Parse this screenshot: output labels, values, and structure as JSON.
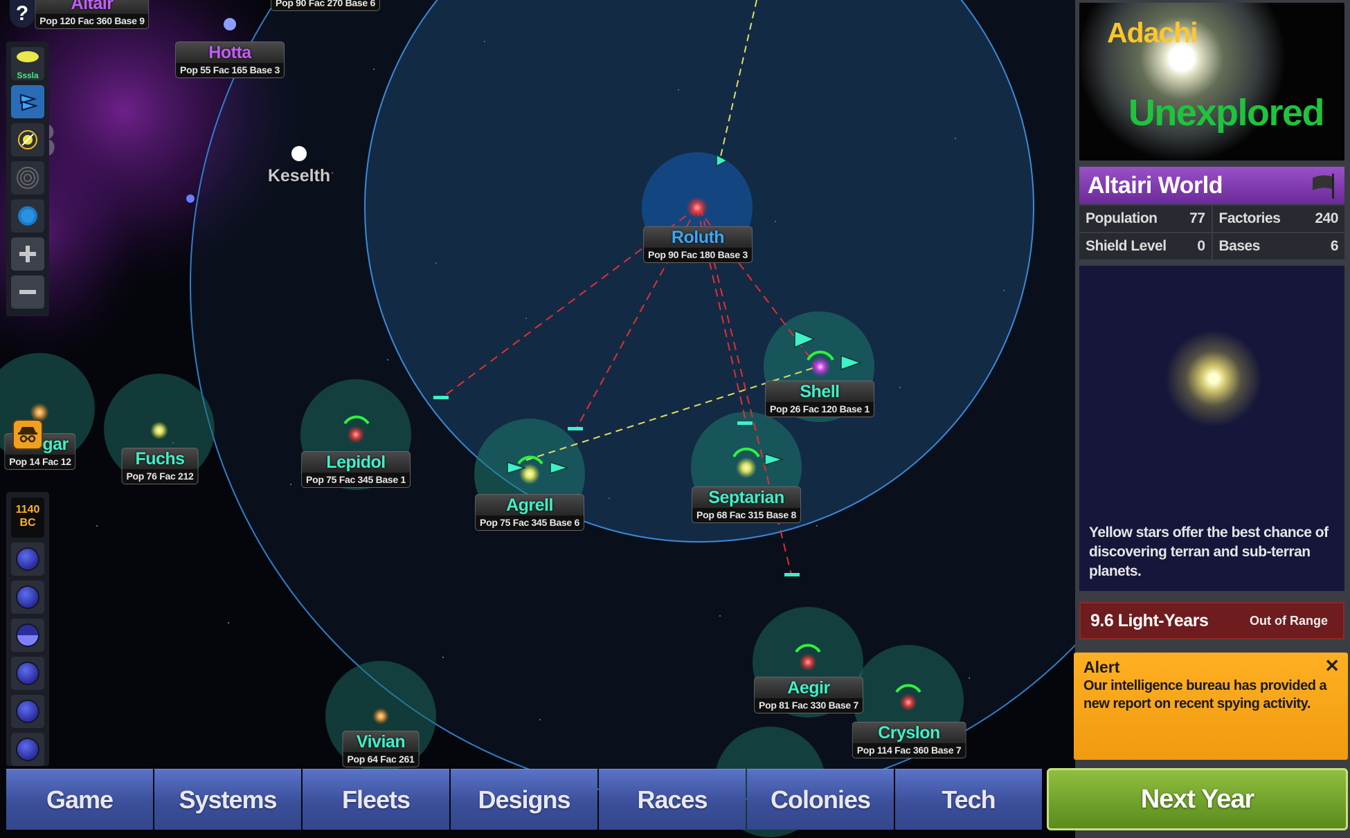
{
  "colors": {
    "accent_name": "#3ff0c8",
    "player_blue": "#3aa8ff",
    "altairi_purple": "#c55cff",
    "nav_blue": "#3b4f9a",
    "next_year_green": "#6fa12a",
    "alert_orange": "#f5a21a",
    "out_of_range_red": "#6e1c1e",
    "star_name_gold": "#ffc629",
    "unexplored_green": "#1ec43e"
  },
  "map": {
    "turn_number_partial": "78",
    "labels": {
      "keselth": "Keselth"
    },
    "systems": [
      {
        "id": "altair",
        "name": "Altair",
        "stats": "Pop 120  Fac 360  Base 9",
        "color": "purple"
      },
      {
        "id": "topcut",
        "name": "",
        "stats": "Pop 90  Fac 270  Base 6",
        "color": "green"
      },
      {
        "id": "hotta",
        "name": "Hotta",
        "stats": "Pop 55  Fac 165  Base 3",
        "color": "purple"
      },
      {
        "id": "roluth",
        "name": "Roluth",
        "stats": "Pop 90  Fac 180  Base 3",
        "color": "blue"
      },
      {
        "id": "shell",
        "name": "Shell",
        "stats": "Pop 26  Fac 120  Base 1",
        "color": "green"
      },
      {
        "id": "gar",
        "name": "gar",
        "stats": "Pop 14  Fac 12",
        "color": "green"
      },
      {
        "id": "fuchs",
        "name": "Fuchs",
        "stats": "Pop 76  Fac 212",
        "color": "green"
      },
      {
        "id": "lepidol",
        "name": "Lepidol",
        "stats": "Pop 75  Fac 345  Base 1",
        "color": "green"
      },
      {
        "id": "agrell",
        "name": "Agrell",
        "stats": "Pop 75  Fac 345  Base 6",
        "color": "green"
      },
      {
        "id": "septarian",
        "name": "Septarian",
        "stats": "Pop 68  Fac 315  Base 8",
        "color": "green"
      },
      {
        "id": "aegir",
        "name": "Aegir",
        "stats": "Pop 81  Fac 330  Base 7",
        "color": "green"
      },
      {
        "id": "cryslon",
        "name": "Cryslon",
        "stats": "Pop 114  Fac 360  Base 7",
        "color": "green"
      },
      {
        "id": "vivian",
        "name": "Vivian",
        "stats": "Pop 64  Fac 261",
        "color": "green"
      }
    ]
  },
  "toolbar": {
    "help": "?",
    "tool_race_label": "Sssla",
    "tools": [
      "race-view",
      "fleet-route",
      "star-target",
      "range-rings",
      "planet-view",
      "zoom-in",
      "zoom-out"
    ],
    "treasury": "1140\nBC",
    "treasury_amount": "1140",
    "treasury_unit": "BC"
  },
  "panel": {
    "star_name": "Adachi",
    "star_status": "Unexplored",
    "world_title": "Altairi World",
    "stats": {
      "population_label": "Population",
      "population": "77",
      "factories_label": "Factories",
      "factories": "240",
      "shield_label": "Shield Level",
      "shield": "0",
      "bases_label": "Bases",
      "bases": "6"
    },
    "description": "Yellow stars offer the best chance of discovering terran and sub-terran planets.",
    "range_value": "9.6 Light-Years",
    "range_status": "Out of Range"
  },
  "alert": {
    "title": "Alert",
    "text": "Our intelligence bureau has provided a new report on recent spying activity.",
    "close": "✕"
  },
  "nav": {
    "items": [
      "Game",
      "Systems",
      "Fleets",
      "Designs",
      "Races",
      "Colonies",
      "Tech"
    ],
    "next_year": "Next Year"
  }
}
